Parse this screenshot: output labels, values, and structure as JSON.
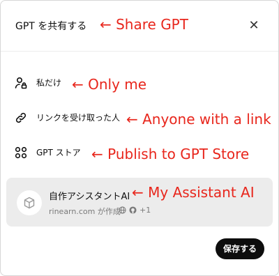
{
  "dialog": {
    "title": "GPT を共有する",
    "close_icon": "close-icon",
    "save_label": "保存する"
  },
  "options": [
    {
      "label": "私だけ",
      "icon": "person-lock-icon"
    },
    {
      "label": "リンクを受け取った人",
      "icon": "link-icon"
    },
    {
      "label": "GPT ストア",
      "icon": "grid-icon"
    }
  ],
  "gpt": {
    "name": "自作アシスタントAI",
    "author": "rinearn.com が作成",
    "extra_count": "+1",
    "avatar_icon": "cube-icon"
  },
  "annotations": {
    "title": "← Share GPT",
    "only_me": "← Only me",
    "link": "← Anyone with a link",
    "store": "← Publish to GPT Store",
    "assistant": "← My Assistant AI"
  },
  "colors": {
    "annotation": "#e8261c",
    "save_button": "#0d0d0d",
    "card_background": "#ececec"
  }
}
